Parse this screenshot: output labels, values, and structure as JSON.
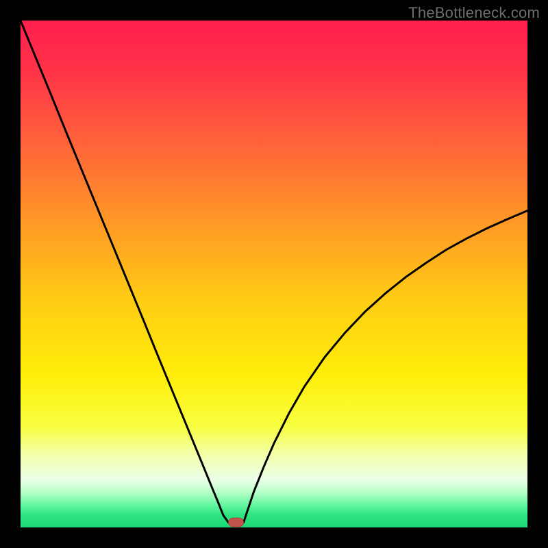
{
  "watermark": "TheBottleneck.com",
  "colors": {
    "frame": "#000000",
    "curve": "#000000",
    "marker_fill": "#c1544c",
    "marker_stroke": "#a6453e",
    "gradient_stops": [
      {
        "offset": 0.0,
        "color": "#ff1f4e"
      },
      {
        "offset": 0.1,
        "color": "#ff3348"
      },
      {
        "offset": 0.25,
        "color": "#ff6638"
      },
      {
        "offset": 0.4,
        "color": "#ff9926"
      },
      {
        "offset": 0.55,
        "color": "#ffcc14"
      },
      {
        "offset": 0.7,
        "color": "#ffee0a"
      },
      {
        "offset": 0.8,
        "color": "#f8ff40"
      },
      {
        "offset": 0.86,
        "color": "#f2ffb0"
      },
      {
        "offset": 0.905,
        "color": "#ecffe8"
      },
      {
        "offset": 0.93,
        "color": "#b8ffc8"
      },
      {
        "offset": 0.955,
        "color": "#66f7a0"
      },
      {
        "offset": 0.975,
        "color": "#2fe582"
      },
      {
        "offset": 1.0,
        "color": "#1ad974"
      }
    ]
  },
  "chart_data": {
    "type": "line",
    "title": "",
    "xlabel": "",
    "ylabel": "",
    "xlim": [
      0,
      100
    ],
    "ylim": [
      0,
      100
    ],
    "legend": false,
    "grid": false,
    "notch_x": 41,
    "marker": {
      "x": 42.5,
      "y": 1.0
    },
    "series": [
      {
        "name": "left-branch",
        "x": [
          0,
          3,
          6,
          9,
          12,
          15,
          18,
          21,
          24,
          27,
          30,
          33,
          36,
          38,
          39,
          40,
          41
        ],
        "y": [
          100,
          92.7,
          85.4,
          78.0,
          70.7,
          63.4,
          56.1,
          48.8,
          41.5,
          34.1,
          26.8,
          19.5,
          12.2,
          7.3,
          4.9,
          2.4,
          1.0
        ]
      },
      {
        "name": "notch-floor",
        "x": [
          41,
          44
        ],
        "y": [
          1.0,
          1.0
        ]
      },
      {
        "name": "right-branch",
        "x": [
          44,
          46,
          48,
          50,
          53,
          56,
          60,
          64,
          68,
          72,
          76,
          80,
          84,
          88,
          92,
          96,
          100
        ],
        "y": [
          1.0,
          7.0,
          12.0,
          16.6,
          22.6,
          27.8,
          33.6,
          38.4,
          42.6,
          46.2,
          49.4,
          52.2,
          54.8,
          57.0,
          59.0,
          60.8,
          62.5
        ]
      }
    ]
  }
}
